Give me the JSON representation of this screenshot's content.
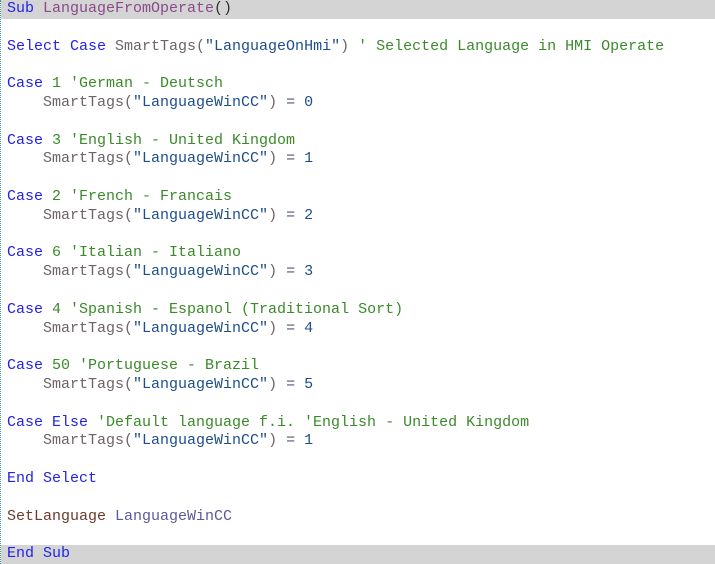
{
  "editor": {
    "lines": [
      {
        "hl": true,
        "tokens": [
          [
            "kw",
            "Sub "
          ],
          [
            "fn",
            "LanguageFromOperate"
          ],
          [
            "pl",
            "()"
          ]
        ]
      },
      {
        "tokens": []
      },
      {
        "tokens": [
          [
            "kw",
            "Select Case "
          ],
          [
            "id",
            "SmartTags("
          ],
          [
            "str",
            "\"LanguageOnHmi\""
          ],
          [
            "id",
            ")"
          ],
          [
            "cm",
            " ' Selected Language in HMI Operate"
          ]
        ]
      },
      {
        "tokens": []
      },
      {
        "tokens": [
          [
            "kw",
            "Case "
          ],
          [
            "cm",
            "1 'German - Deutsch"
          ]
        ]
      },
      {
        "tokens": [
          [
            "id",
            "    SmartTags("
          ],
          [
            "str",
            "\"LanguageWinCC\""
          ],
          [
            "id",
            ")"
          ],
          [
            "op",
            " = "
          ],
          [
            "num",
            "0"
          ]
        ]
      },
      {
        "tokens": []
      },
      {
        "tokens": [
          [
            "kw",
            "Case "
          ],
          [
            "cm",
            "3 'English - United Kingdom"
          ]
        ]
      },
      {
        "tokens": [
          [
            "id",
            "    SmartTags("
          ],
          [
            "str",
            "\"LanguageWinCC\""
          ],
          [
            "id",
            ")"
          ],
          [
            "op",
            " = "
          ],
          [
            "num",
            "1"
          ]
        ]
      },
      {
        "tokens": []
      },
      {
        "tokens": [
          [
            "kw",
            "Case "
          ],
          [
            "cm",
            "2 'French - Francais"
          ]
        ]
      },
      {
        "tokens": [
          [
            "id",
            "    SmartTags("
          ],
          [
            "str",
            "\"LanguageWinCC\""
          ],
          [
            "id",
            ")"
          ],
          [
            "op",
            " = "
          ],
          [
            "num",
            "2"
          ]
        ]
      },
      {
        "tokens": []
      },
      {
        "tokens": [
          [
            "kw",
            "Case "
          ],
          [
            "cm",
            "6 'Italian - Italiano"
          ]
        ]
      },
      {
        "tokens": [
          [
            "id",
            "    SmartTags("
          ],
          [
            "str",
            "\"LanguageWinCC\""
          ],
          [
            "id",
            ")"
          ],
          [
            "op",
            " = "
          ],
          [
            "num",
            "3"
          ]
        ]
      },
      {
        "tokens": []
      },
      {
        "tokens": [
          [
            "kw",
            "Case "
          ],
          [
            "cm",
            "4 'Spanish - Espanol (Traditional Sort)"
          ]
        ]
      },
      {
        "tokens": [
          [
            "id",
            "    SmartTags("
          ],
          [
            "str",
            "\"LanguageWinCC\""
          ],
          [
            "id",
            ")"
          ],
          [
            "op",
            " = "
          ],
          [
            "num",
            "4"
          ]
        ]
      },
      {
        "tokens": []
      },
      {
        "tokens": [
          [
            "kw",
            "Case "
          ],
          [
            "cm",
            "50 'Portuguese - Brazil"
          ]
        ]
      },
      {
        "tokens": [
          [
            "id",
            "    SmartTags("
          ],
          [
            "str",
            "\"LanguageWinCC\""
          ],
          [
            "id",
            ")"
          ],
          [
            "op",
            " = "
          ],
          [
            "num",
            "5"
          ]
        ]
      },
      {
        "tokens": []
      },
      {
        "tokens": [
          [
            "kw",
            "Case Else "
          ],
          [
            "cm",
            "'Default language f.i. 'English - United Kingdom"
          ]
        ]
      },
      {
        "tokens": [
          [
            "id",
            "    SmartTags("
          ],
          [
            "str",
            "\"LanguageWinCC\""
          ],
          [
            "id",
            ")"
          ],
          [
            "op",
            " = "
          ],
          [
            "num",
            "1"
          ]
        ]
      },
      {
        "tokens": []
      },
      {
        "tokens": [
          [
            "kw",
            "End Select"
          ]
        ]
      },
      {
        "tokens": []
      },
      {
        "tokens": [
          [
            "call",
            "SetLanguage "
          ],
          [
            "var",
            "LanguageWinCC"
          ]
        ]
      },
      {
        "tokens": []
      },
      {
        "hl": true,
        "tokens": [
          [
            "kw",
            "End Sub"
          ]
        ]
      }
    ]
  }
}
